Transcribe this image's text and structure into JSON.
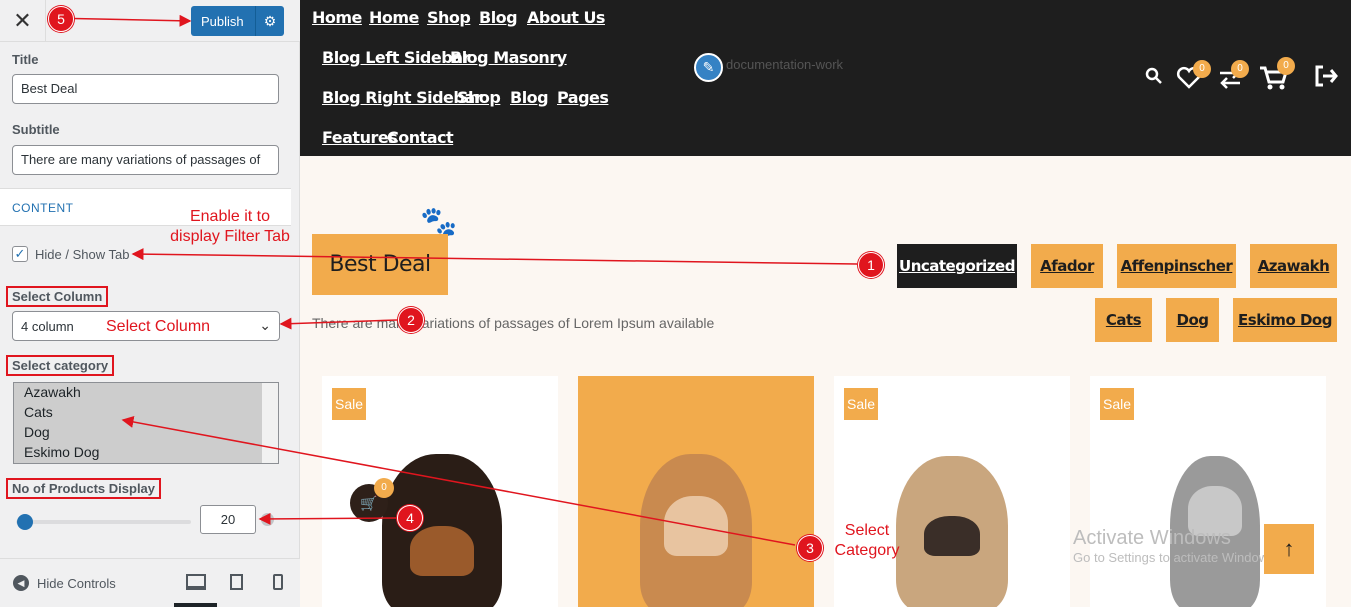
{
  "sidebar": {
    "close_glyph": "✕",
    "publish_label": "Publish",
    "title_label": "Title",
    "title_value": "Best Deal",
    "subtitle_label": "Subtitle",
    "subtitle_value": "There are many variations of passages of",
    "content_heading": "CONTENT",
    "hide_show_label": "Hide / Show Tab",
    "hide_show_checked": true,
    "select_column_label": "Select Column",
    "select_column_value": "4 column",
    "select_category_label": "Select category",
    "categories": [
      "Azawakh",
      "Cats",
      "Dog",
      "Eskimo Dog"
    ],
    "products_display_label": "No of Products Display",
    "products_display_value": "20",
    "hide_controls_label": "Hide Controls"
  },
  "preview": {
    "nav_row1": [
      "Home",
      "Home",
      "Shop",
      "Blog",
      "About Us"
    ],
    "nav_row2": [
      "Blog Left Sidebar",
      "Blog Masonry"
    ],
    "nav_row3": [
      "Blog Right Sidebar",
      "Shop",
      "Blog",
      "Pages"
    ],
    "nav_row4": [
      "Features",
      "Contact"
    ],
    "logo_alt": "documentation-work",
    "wishlist_count": "0",
    "compare_count": "0",
    "cart_count": "0",
    "section_title": "Best Deal",
    "section_subtitle": "There are many variations of passages of Lorem Ipsum available",
    "filter_tabs_row1": [
      "Uncategorized",
      "Afador",
      "Affenpinscher",
      "Azawakh"
    ],
    "filter_tabs_row2": [
      "Cats",
      "Dog",
      "Eskimo Dog"
    ],
    "active_tab": "Uncategorized",
    "sale_badge": "Sale",
    "product_cart_count": "0",
    "scroll_top_glyph": "↑",
    "activate_line1": "Activate Windows",
    "activate_line2": "Go to Settings to activate Windows."
  },
  "annotations": {
    "n1": "1",
    "n2": "2",
    "n3": "3",
    "n4": "4",
    "n5": "5",
    "enable_text_line1": "Enable it to",
    "enable_text_line2": "display Filter Tab",
    "select_column_text": "Select Column",
    "select_category_line1": "Select",
    "select_category_line2": "Category"
  },
  "colors": {
    "accent": "#f2ab4c",
    "header_bg": "#1e1e1e",
    "publish_blue": "#2271b1",
    "annotation_red": "#e0151e"
  }
}
